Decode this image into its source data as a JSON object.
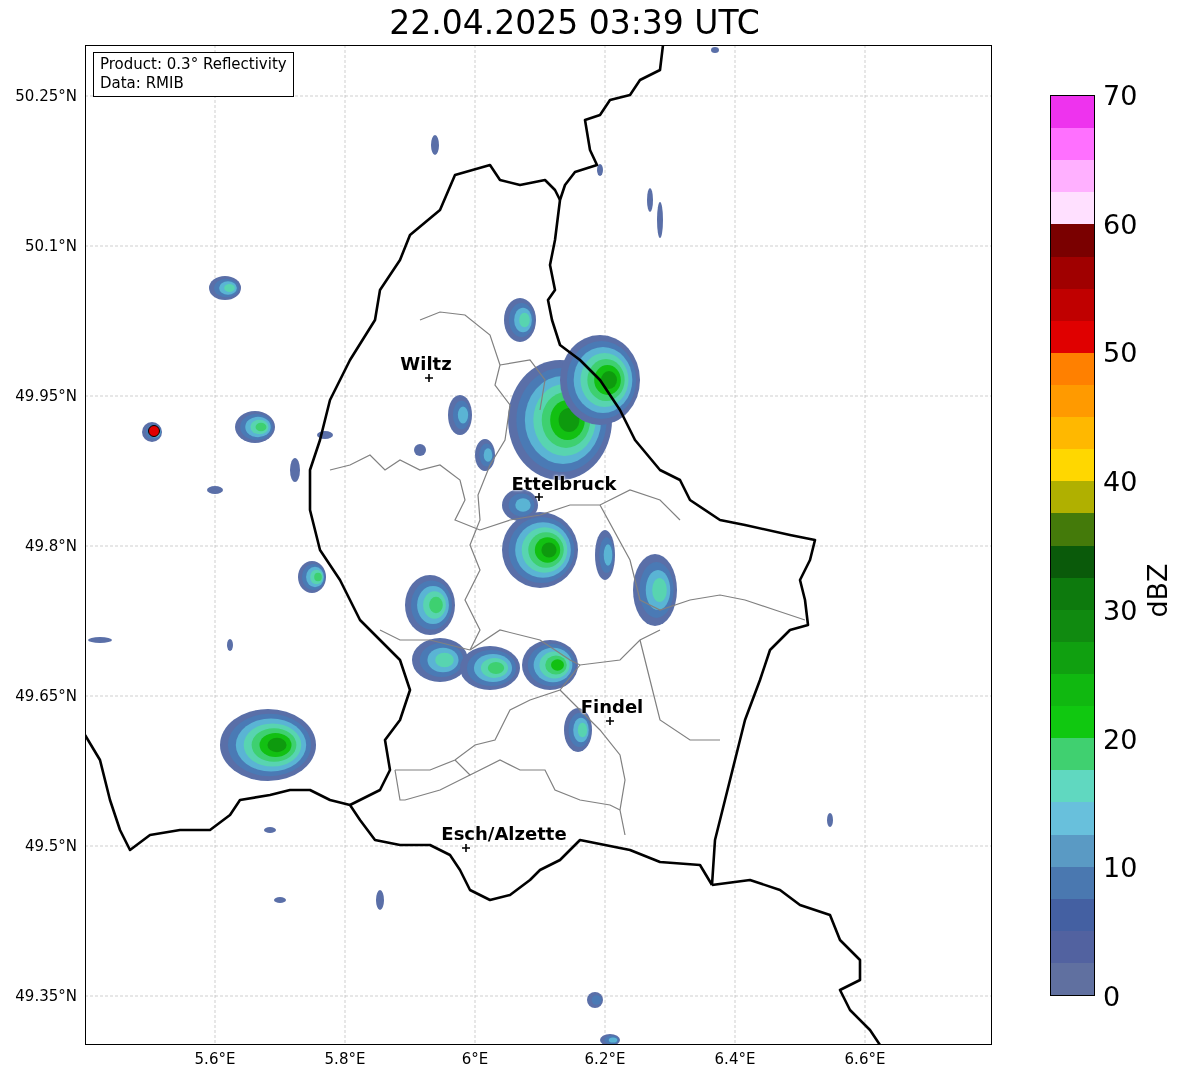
{
  "title": "22.04.2025 03:39 UTC",
  "legend": {
    "lines": [
      "Product: 0.3° Reflectivity",
      "Data: RMIB"
    ]
  },
  "axes": {
    "yticks": [
      "50.25°N",
      "50.1°N",
      "49.95°N",
      "49.8°N",
      "49.65°N",
      "49.5°N",
      "49.35°N"
    ],
    "xticks": [
      "5.6°E",
      "5.8°E",
      "6°E",
      "6.2°E",
      "6.4°E",
      "6.6°E"
    ]
  },
  "cities": [
    {
      "name": "Wiltz"
    },
    {
      "name": "Ettelbruck"
    },
    {
      "name": "Findel"
    },
    {
      "name": "Esch/Alzette"
    }
  ],
  "colorbar": {
    "label": "dBZ",
    "ticks": [
      "70",
      "60",
      "50",
      "40",
      "30",
      "20",
      "10",
      "0"
    ],
    "bins": [
      {
        "color": "#6070a0"
      },
      {
        "color": "#5262a0"
      },
      {
        "color": "#4460a2"
      },
      {
        "color": "#4a78b0"
      },
      {
        "color": "#5a9ac4"
      },
      {
        "color": "#68c0dc"
      },
      {
        "color": "#60d8c0"
      },
      {
        "color": "#40d070"
      },
      {
        "color": "#10c810"
      },
      {
        "color": "#10b810"
      },
      {
        "color": "#10a010"
      },
      {
        "color": "#108a10"
      },
      {
        "color": "#0d7a0d"
      },
      {
        "color": "#0a5a0a"
      },
      {
        "color": "#447a0a"
      },
      {
        "color": "#b0b000"
      },
      {
        "color": "#ffd700"
      },
      {
        "color": "#ffb800"
      },
      {
        "color": "#ff9a00"
      },
      {
        "color": "#ff8000"
      },
      {
        "color": "#e00000"
      },
      {
        "color": "#c00000"
      },
      {
        "color": "#a00000"
      },
      {
        "color": "#7a0000"
      },
      {
        "color": "#ffe0ff"
      },
      {
        "color": "#ffb0ff"
      },
      {
        "color": "#ff70ff"
      },
      {
        "color": "#ee33ee"
      }
    ]
  }
}
